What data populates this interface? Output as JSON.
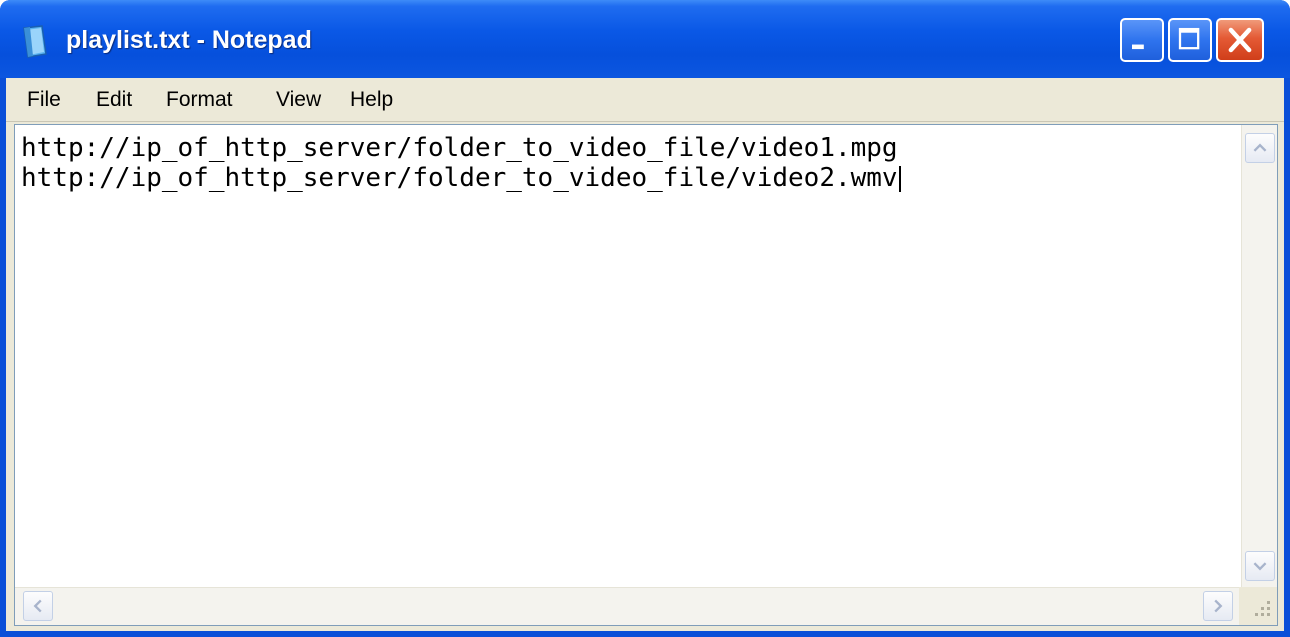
{
  "window": {
    "title": "playlist.txt - Notepad",
    "icon": "notepad-icon"
  },
  "title_buttons": {
    "minimize": "minimize-icon",
    "maximize": "maximize-icon",
    "close": "close-icon"
  },
  "menu": {
    "items": [
      {
        "label": "File"
      },
      {
        "label": "Edit"
      },
      {
        "label": "Format"
      },
      {
        "label": "View"
      },
      {
        "label": "Help"
      }
    ]
  },
  "editor": {
    "lines": [
      "http://ip_of_http_server/folder_to_video_file/video1.mpg",
      "http://ip_of_http_server/folder_to_video_file/video2.wmv"
    ]
  },
  "colors": {
    "titlebar": "#0a58e6",
    "close_button": "#e45a35",
    "frame": "#ece9d8"
  }
}
